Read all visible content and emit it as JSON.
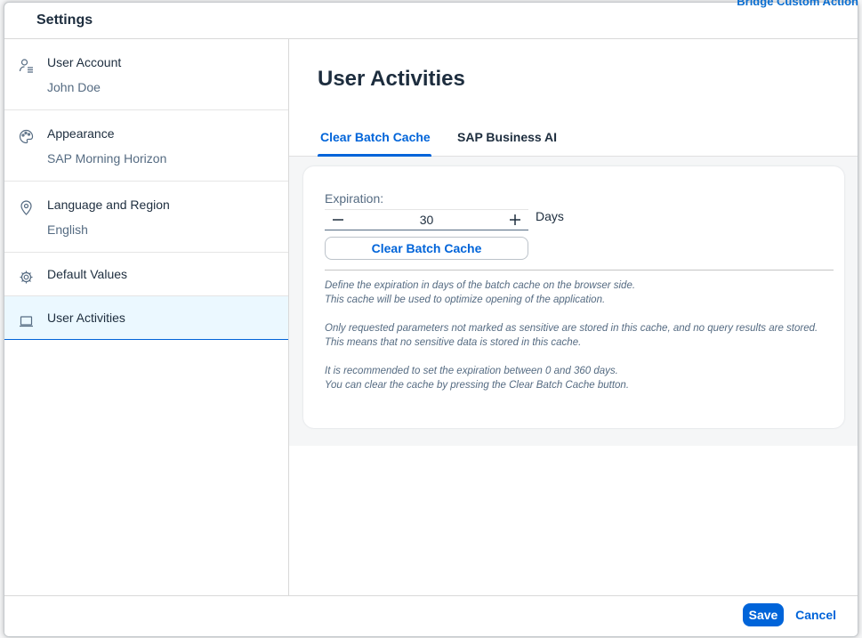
{
  "dialog": {
    "title": "Settings"
  },
  "background": {
    "peek_text": "Bridge Custom Action"
  },
  "sidebar": {
    "items": [
      {
        "label": "User Account",
        "sublabel": "John Doe",
        "icon": "user-settings-icon"
      },
      {
        "label": "Appearance",
        "sublabel": "SAP Morning Horizon",
        "icon": "palette-icon"
      },
      {
        "label": "Language and Region",
        "sublabel": "English",
        "icon": "location-pin-icon"
      },
      {
        "label": "Default Values",
        "icon": "gear-icon"
      },
      {
        "label": "User Activities",
        "icon": "laptop-icon",
        "selected": true
      }
    ]
  },
  "content": {
    "title": "User Activities",
    "tabs": [
      {
        "label": "Clear Batch Cache",
        "active": true
      },
      {
        "label": "SAP Business AI",
        "active": false
      }
    ],
    "expiration_label": "Expiration:",
    "expiration_value": "30",
    "days_label": "Days",
    "clear_button": "Clear Batch Cache",
    "help": [
      [
        "Define the expiration in days of the batch cache on the browser side.",
        "This cache will be used to optimize opening of the application."
      ],
      [
        "Only requested parameters not marked as sensitive are stored in this cache, and no query results are stored.",
        "This means that no sensitive data is stored in this cache."
      ],
      [
        "It is recommended to set the expiration between 0 and 360 days.",
        "You can clear the cache by pressing the Clear Batch Cache button."
      ]
    ]
  },
  "footer": {
    "save_label": "Save",
    "cancel_label": "Cancel"
  },
  "colors": {
    "accent": "#0064d9",
    "selected_bg": "#ebf8ff",
    "text": "#1d2d3e",
    "subtext": "#556b82"
  }
}
